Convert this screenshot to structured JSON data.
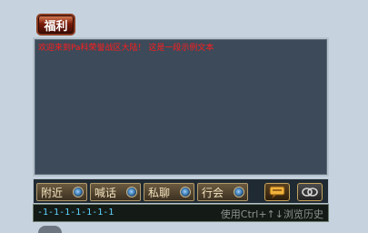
{
  "welfare_button": {
    "label": "福利"
  },
  "chat": {
    "message": "欢迎来到Pa科荣誉战区大陆！ 这是一段示例文本"
  },
  "tabs": [
    {
      "label": "附近",
      "icon": "blue-orb-icon"
    },
    {
      "label": "喊话",
      "icon": "blue-orb-icon"
    },
    {
      "label": "私聊",
      "icon": "blue-orb-icon"
    },
    {
      "label": "行会",
      "icon": "blue-orb-icon"
    }
  ],
  "tool_buttons": [
    {
      "icon": "speech-bubble-icon"
    },
    {
      "icon": "chain-link-icon"
    }
  ],
  "input": {
    "value": "-1-1-1-1-1-1-1",
    "hint": "使用Ctrl+↑↓浏览历史"
  },
  "colors": {
    "chat_text": "#ff1d1d",
    "input_text": "#5fd0ff",
    "tab_text": "#f2e2bd",
    "chat_bg": "#3c4a59",
    "page_bg": "#c6d3df"
  }
}
